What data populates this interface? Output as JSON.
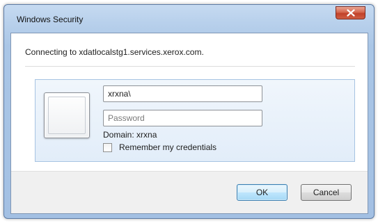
{
  "window": {
    "title": "Windows Security",
    "close_symbol": "close-icon"
  },
  "dialog": {
    "connecting_text": "Connecting to xdatlocalstg1.services.xerox.com.",
    "username_value": "xrxna\\",
    "password_placeholder": "Password",
    "domain_text": "Domain: xrxna",
    "remember_label": "Remember my credentials",
    "remember_checked": false
  },
  "buttons": {
    "ok_label": "OK",
    "cancel_label": "Cancel"
  },
  "colors": {
    "frame": "#b9d1ec",
    "close_button": "#c1412a",
    "panel": "#e2edf9",
    "ok_button": "#bee6fd"
  }
}
